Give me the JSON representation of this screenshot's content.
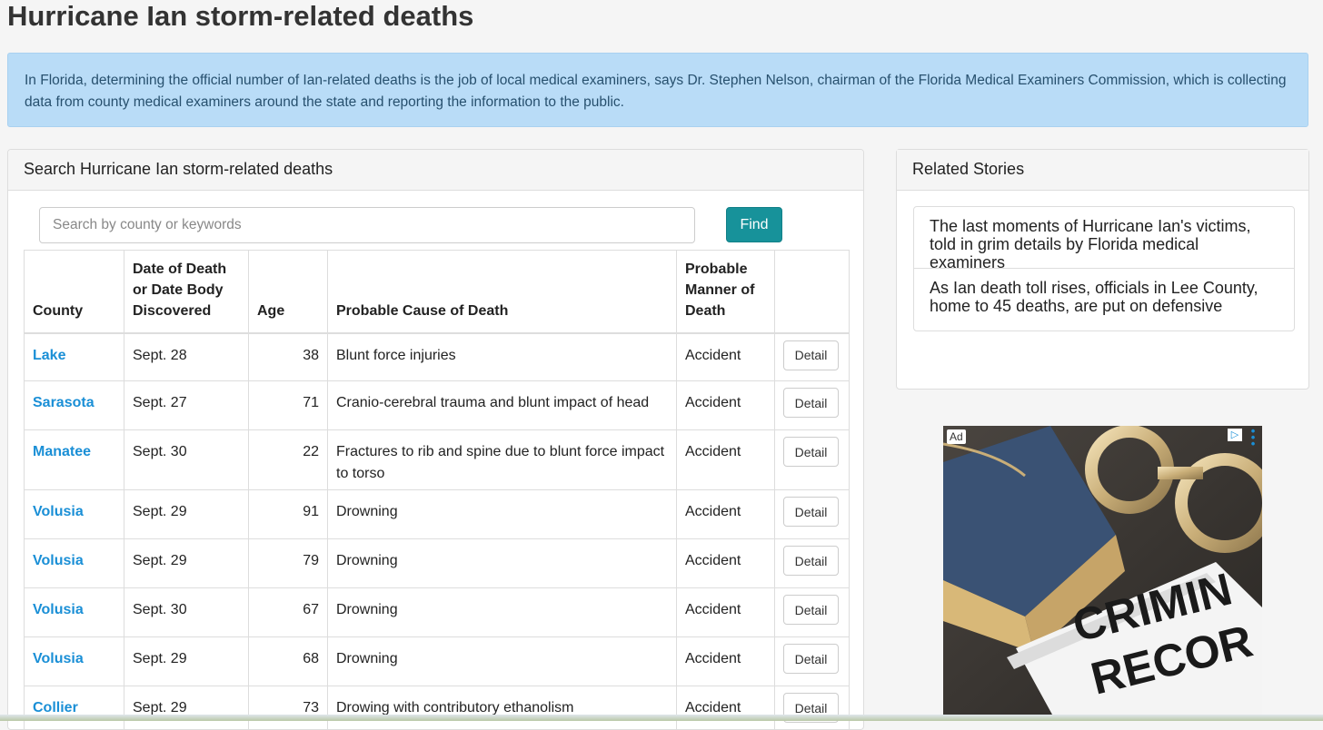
{
  "page": {
    "title": "Hurricane Ian storm-related deaths",
    "info": "In Florida, determining the official number of Ian-related deaths is the job of local medical examiners, says Dr. Stephen Nelson, chairman of the Florida Medical Examiners Commission, which is collecting data from county medical examiners around the state and reporting the information to the public."
  },
  "search": {
    "heading": "Search Hurricane Ian storm-related deaths",
    "placeholder": "Search by county or keywords",
    "find_label": "Find"
  },
  "table": {
    "headers": [
      "County",
      "Date of Death or Date Body Discovered",
      "Age",
      "Probable Cause of Death",
      "Probable Manner of Death",
      ""
    ],
    "detail_label": "Detail",
    "rows": [
      {
        "county": "Lake",
        "date": "Sept. 28",
        "age": "38",
        "cause": "Blunt force injuries",
        "manner": "Accident"
      },
      {
        "county": "Sarasota",
        "date": "Sept. 27",
        "age": "71",
        "cause": "Cranio-cerebral trauma and blunt impact of head",
        "manner": "Accident"
      },
      {
        "county": "Manatee",
        "date": "Sept. 30",
        "age": "22",
        "cause": "Fractures to rib and spine due to blunt force impact to torso",
        "manner": "Accident"
      },
      {
        "county": "Volusia",
        "date": "Sept. 29",
        "age": "91",
        "cause": "Drowning",
        "manner": "Accident"
      },
      {
        "county": "Volusia",
        "date": "Sept. 29",
        "age": "79",
        "cause": "Drowning",
        "manner": "Accident"
      },
      {
        "county": "Volusia",
        "date": "Sept. 30",
        "age": "67",
        "cause": "Drowning",
        "manner": "Accident"
      },
      {
        "county": "Volusia",
        "date": "Sept. 29",
        "age": "68",
        "cause": "Drowning",
        "manner": "Accident"
      },
      {
        "county": "Collier",
        "date": "Sept. 29",
        "age": "73",
        "cause": "Drowing with contributory ethanolism",
        "manner": "Accident"
      }
    ]
  },
  "related": {
    "heading": "Related Stories",
    "stories": [
      "The last moments of Hurricane Ian's victims, told in grim details by Florida medical examiners",
      "As Ian death toll rises, officials in Lee County, home to 45 deaths, are put on defensive"
    ]
  },
  "ad": {
    "label": "Ad",
    "image_text_line1": "CRIMIN",
    "image_text_line2": "RECOR",
    "choices_icon": "ad-choices-icon",
    "menu_icon": "vertical-dots-icon"
  },
  "colors": {
    "accent": "#17929a",
    "link": "#1a8fd6",
    "info_bg": "#b9dcf7"
  }
}
